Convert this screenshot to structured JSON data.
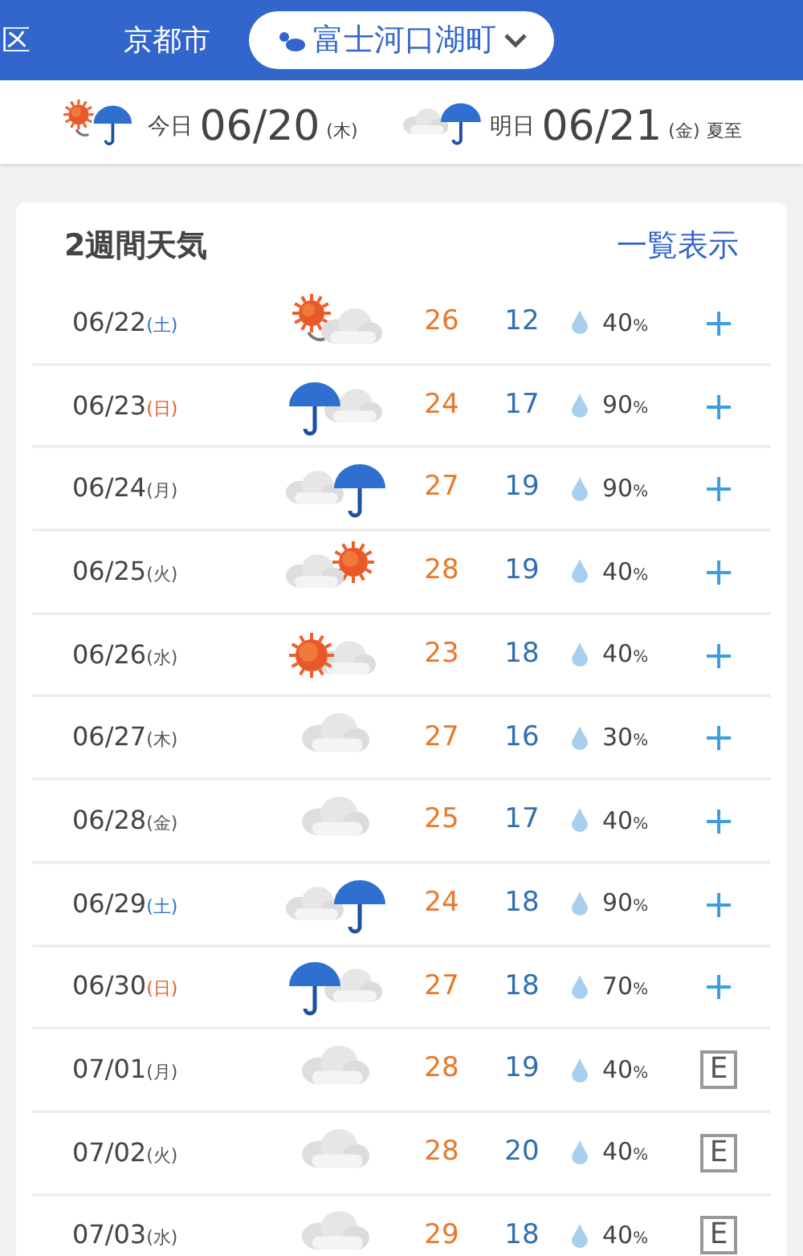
{
  "area_tabs": [
    {
      "label": "区",
      "selected": false
    },
    {
      "label": "京都市",
      "selected": false
    },
    {
      "label": "富士河口湖町",
      "selected": true
    }
  ],
  "days": [
    {
      "label": "今日",
      "date": "06/20",
      "weekday": "(木)",
      "icon": {
        "kind": "sun_to_rain"
      }
    },
    {
      "label": "明日",
      "date": "06/21",
      "weekday": "(金)",
      "note": "夏至",
      "icon": {
        "kind": "cloud_rain"
      }
    }
  ],
  "forecast": {
    "title": "2週間天気",
    "link": "一覧表示",
    "rows": [
      {
        "date": "06/22",
        "weekday": "(土)",
        "color": "#2f6fd0",
        "icon": {
          "kind": "sun_to_cloud"
        },
        "high": "26",
        "low": "12",
        "rain": "40",
        "unit": "%",
        "rank": {
          "text": "+",
          "kind": "plus"
        }
      },
      {
        "date": "06/23",
        "weekday": "(日)",
        "color": "#e8582a",
        "icon": {
          "kind": "rain_cloud"
        },
        "high": "24",
        "low": "17",
        "rain": "90",
        "unit": "%",
        "rank": {
          "text": "+",
          "kind": "plus"
        }
      },
      {
        "date": "06/24",
        "weekday": "(月)",
        "color": "#555555",
        "icon": {
          "kind": "cloud_rain"
        },
        "high": "27",
        "low": "19",
        "rain": "90",
        "unit": "%",
        "rank": {
          "text": "+",
          "kind": "plus"
        }
      },
      {
        "date": "06/25",
        "weekday": "(火)",
        "color": "#555555",
        "icon": {
          "kind": "cloud_sun"
        },
        "high": "28",
        "low": "19",
        "rain": "40",
        "unit": "%",
        "rank": {
          "text": "+",
          "kind": "plus"
        }
      },
      {
        "date": "06/26",
        "weekday": "(水)",
        "color": "#555555",
        "icon": {
          "kind": "sun_cloud"
        },
        "high": "23",
        "low": "18",
        "rain": "40",
        "unit": "%",
        "rank": {
          "text": "+",
          "kind": "plus"
        }
      },
      {
        "date": "06/27",
        "weekday": "(木)",
        "color": "#555555",
        "icon": {
          "kind": "cloud"
        },
        "high": "27",
        "low": "16",
        "rain": "30",
        "unit": "%",
        "rank": {
          "text": "+",
          "kind": "plus"
        }
      },
      {
        "date": "06/28",
        "weekday": "(金)",
        "color": "#555555",
        "icon": {
          "kind": "cloud"
        },
        "high": "25",
        "low": "17",
        "rain": "40",
        "unit": "%",
        "rank": {
          "text": "+",
          "kind": "plus"
        }
      },
      {
        "date": "06/29",
        "weekday": "(土)",
        "color": "#2f6fd0",
        "icon": {
          "kind": "cloud_rain"
        },
        "high": "24",
        "low": "18",
        "rain": "90",
        "unit": "%",
        "rank": {
          "text": "+",
          "kind": "plus"
        }
      },
      {
        "date": "06/30",
        "weekday": "(日)",
        "color": "#e8582a",
        "icon": {
          "kind": "rain_cloud"
        },
        "high": "27",
        "low": "18",
        "rain": "70",
        "unit": "%",
        "rank": {
          "text": "+",
          "kind": "plus"
        }
      },
      {
        "date": "07/01",
        "weekday": "(月)",
        "color": "#555555",
        "icon": {
          "kind": "cloud"
        },
        "high": "28",
        "low": "19",
        "rain": "40",
        "unit": "%",
        "rank": {
          "text": "E",
          "kind": "boxed"
        }
      },
      {
        "date": "07/02",
        "weekday": "(火)",
        "color": "#555555",
        "icon": {
          "kind": "cloud"
        },
        "high": "28",
        "low": "20",
        "rain": "40",
        "unit": "%",
        "rank": {
          "text": "E",
          "kind": "boxed"
        }
      },
      {
        "date": "07/03",
        "weekday": "(水)",
        "color": "#555555",
        "icon": {
          "kind": "cloud"
        },
        "high": "29",
        "low": "18",
        "rain": "40",
        "unit": "%",
        "rank": {
          "text": "E",
          "kind": "boxed"
        }
      }
    ]
  }
}
